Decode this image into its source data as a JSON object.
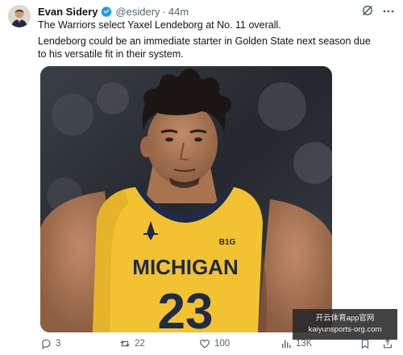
{
  "tweet": {
    "author": {
      "display_name": "Evan Sidery",
      "handle": "@esidery",
      "time": "44m",
      "separator": "·",
      "verified": true,
      "verified_color": "#1d9bf0"
    },
    "text_line1": "The Warriors select Yaxel Lendeborg at No. 11 overall.",
    "text_line2": "Lendeborg could be an immediate starter in Golden State next season due to his versatile fit in their system.",
    "media": {
      "jersey_text": "MICHIGAN",
      "jersey_number": "23",
      "conference_logo_text": "B1G",
      "jersey_color": "#f2c230",
      "trim_color": "#1e2a4a"
    },
    "actions": {
      "replies": "3",
      "reposts": "22",
      "likes": "100",
      "views": "13K"
    }
  },
  "watermark": {
    "line1": "开云体育app官网",
    "line2": "kaiyunsports-org.com"
  },
  "icons": [
    "verified-badge-icon",
    "grok-icon",
    "more-icon",
    "reply-icon",
    "repost-icon",
    "like-icon",
    "views-icon",
    "bookmark-icon",
    "share-icon"
  ]
}
